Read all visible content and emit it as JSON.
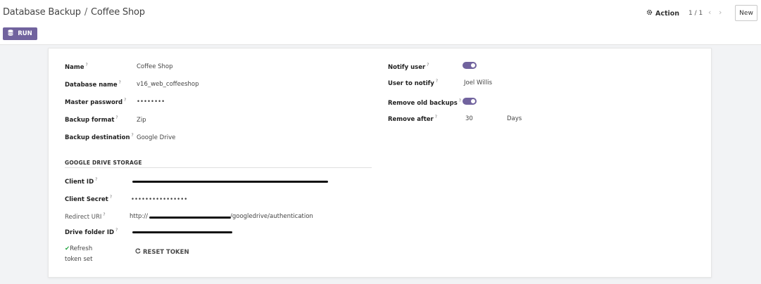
{
  "breadcrumb": {
    "parent": "Database Backup",
    "separator": "/",
    "current": "Coffee Shop"
  },
  "controls": {
    "action_label": "Action",
    "pager": "1 / 1",
    "new_label": "New",
    "run_label": "RUN"
  },
  "form": {
    "name_label": "Name",
    "name_value": "Coffee Shop",
    "database_label": "Database name",
    "database_value": "v16_web_coffeeshop",
    "master_password_label": "Master password",
    "master_password_value": "••••••••",
    "backup_format_label": "Backup format",
    "backup_format_value": "Zip",
    "backup_destination_label": "Backup destination",
    "backup_destination_value": "Google Drive",
    "notify_user_label": "Notify user",
    "notify_user_enabled": true,
    "user_to_notify_label": "User to notify",
    "user_to_notify_value": "Joel Willis",
    "remove_old_label": "Remove old backups",
    "remove_old_enabled": true,
    "remove_after_label": "Remove after",
    "remove_after_value": "30",
    "remove_after_unit": "Days"
  },
  "gdrive": {
    "section_title": "GOOGLE DRIVE STORAGE",
    "client_id_label": "Client ID",
    "client_secret_label": "Client Secret",
    "client_secret_value": "••••••••••••••••",
    "redirect_uri_label": "Redirect URI",
    "redirect_uri_start": "http://",
    "redirect_uri_end": "/googledrive/authentication",
    "drive_folder_label": "Drive folder ID",
    "refresh_label": "Refresh",
    "token_set_label": "token set",
    "reset_token_label": "RESET TOKEN"
  },
  "colors": {
    "primary": "#71639e",
    "check": "#28a745"
  }
}
